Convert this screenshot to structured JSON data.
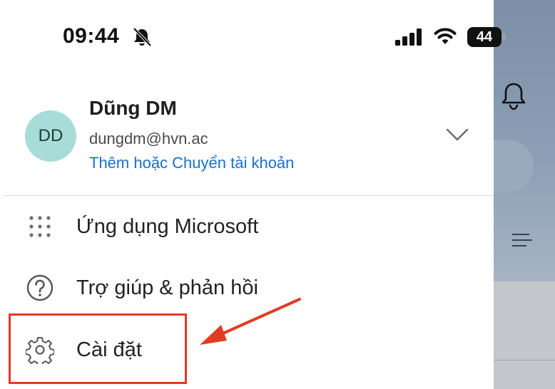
{
  "status_bar": {
    "time": "09:44",
    "battery": "44"
  },
  "account": {
    "initials": "DD",
    "name": "Dũng DM",
    "email": "dungdm@hvn.ac",
    "switch_link": "Thêm hoặc Chuyển tài khoản"
  },
  "menu": {
    "items": [
      {
        "label": "Ứng dụng Microsoft",
        "icon": "apps-grid-icon"
      },
      {
        "label": "Trợ giúp & phản hồi",
        "icon": "help-icon"
      },
      {
        "label": "Cài đặt",
        "icon": "gear-icon"
      }
    ]
  },
  "colors": {
    "accent_link": "#1a6fd0",
    "avatar_bg": "#a8dcd8",
    "annotation_red": "#e23b24"
  }
}
